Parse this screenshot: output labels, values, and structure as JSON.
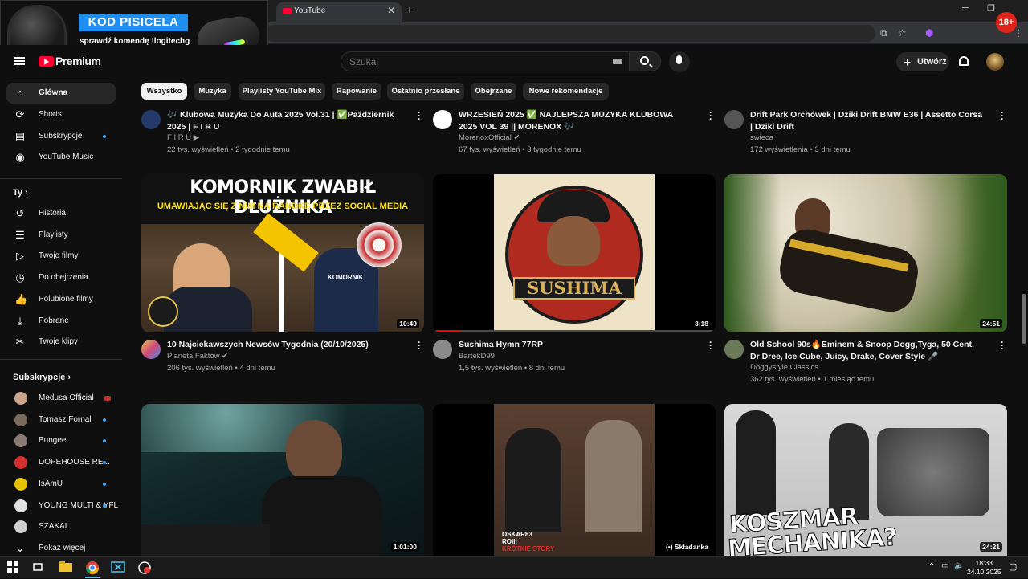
{
  "browser": {
    "tab_title": "YouTube",
    "tab_close": "✕",
    "new_tab": "+",
    "window_controls": [
      "─",
      "❐",
      "✕"
    ],
    "toolbar_icons": [
      "⧉",
      "☆",
      "⬢",
      "⋮"
    ]
  },
  "ad": {
    "badge": "KOD PISICELA",
    "tagline": "sprawdź komendę !logitechg",
    "age_badge": "18+"
  },
  "header": {
    "logo_text": "Premium",
    "search_placeholder": "Szukaj",
    "create_label": "Utwórz"
  },
  "sidebar": {
    "main": [
      {
        "label": "Główna",
        "icon": "home-icon",
        "glyph": "⌂"
      },
      {
        "label": "Shorts",
        "icon": "shorts-icon",
        "glyph": "⟳"
      },
      {
        "label": "Subskrypcje",
        "icon": "subscriptions-icon",
        "glyph": "▤"
      },
      {
        "label": "YouTube Music",
        "icon": "music-icon",
        "glyph": "◉"
      }
    ],
    "you_heading": "Ty",
    "you": [
      {
        "label": "Historia",
        "icon": "history-icon",
        "glyph": "↺"
      },
      {
        "label": "Playlisty",
        "icon": "playlists-icon",
        "glyph": "☰"
      },
      {
        "label": "Twoje filmy",
        "icon": "your-videos-icon",
        "glyph": "▷"
      },
      {
        "label": "Do obejrzenia",
        "icon": "watch-later-icon",
        "glyph": "◷"
      },
      {
        "label": "Polubione filmy",
        "icon": "liked-icon",
        "glyph": "👍"
      },
      {
        "label": "Pobrane",
        "icon": "download-icon",
        "glyph": "⤓"
      },
      {
        "label": "Twoje klipy",
        "icon": "clips-icon",
        "glyph": "✂"
      }
    ],
    "subs_heading": "Subskrypcje",
    "subs": [
      {
        "label": "Medusa Official",
        "color": "#c9a48b"
      },
      {
        "label": "Tomasz Fornal",
        "color": "#7a6a5c"
      },
      {
        "label": "Bungee",
        "color": "#8b7b74"
      },
      {
        "label": "DOPEHOUSE RE...",
        "color": "#d32f2f"
      },
      {
        "label": "IsAmU",
        "color": "#e6c200"
      },
      {
        "label": "YOUNG MULTI & YFL",
        "color": "#e0e0e0"
      },
      {
        "label": "SZAKAL",
        "color": "#cfcfcf"
      }
    ],
    "show_more": "Pokaż więcej"
  },
  "chips": [
    "Wszystko",
    "Muzyka",
    "Playlisty YouTube Mix",
    "Rapowanie",
    "Ostatnio przesłane",
    "Obejrzane",
    "Nowe rekomendacje"
  ],
  "videos_top": [
    {
      "title": "🎶 Klubowa Muzyka Do Auta 2025 Vol.31 | ✅Październik 2025 | F I R U",
      "channel": "F I R U ▶",
      "meta": "22 tys. wyświetleń • 2 tygodnie temu",
      "avatar": "#233a6b"
    },
    {
      "title": "WRZESIEŃ 2025 ✅ NAJLEPSZA MUZYKA KLUBOWA 2025 VOL 39 || MORENOX 🎶",
      "channel": "MorenoxOfficial ✔",
      "meta": "67 tys. wyświetleń • 3 tygodnie temu",
      "avatar": "#ffffff"
    },
    {
      "title": "Drift Park Orchówek | Dziki Drift BMW E36 | Assetto Corsa | Dziki Drift",
      "channel": "swieca",
      "meta": "172 wyświetlenia • 3 dni temu",
      "avatar": "#555555"
    }
  ],
  "videos_mid": [
    {
      "title": "10 Najciekawszych Newsów Tygodnia (20/10/2025)",
      "channel": "Planeta Faktów ✔",
      "meta": "206 tys. wyświetleń • 4 dni temu",
      "duration": "10:49",
      "thumb_line1": "KOMORNIK ZWABIŁ DŁUŻNIKA",
      "thumb_line2": "UMAWIAJĄC SIĘ Z NIM NA RANDKĘ PRZEZ SOCIAL MEDIA",
      "jacket_text": "KOMORNIK"
    },
    {
      "title": "Sushima Hymn 77RP",
      "channel": "BartekD99",
      "meta": "1,5 tys. wyświetleń • 8 dni temu",
      "duration": "3:18",
      "thumb_text": "SUSHIMA",
      "watched_progress": 0.1
    },
    {
      "title": "Old School 90s🔥Eminem & Snoop Dogg,Tyga, 50 Cent, Dr Dree, Ice Cube, Juicy, Drake, Cover Style 🎤",
      "channel": "Doggystyle Classics",
      "meta": "362 tys. wyświetleń • 1 miesiąc temu",
      "duration": "24:51"
    }
  ],
  "videos_bottom": [
    {
      "duration": "1:01:00"
    },
    {
      "duration": "(•) Składanka",
      "thumb_text1": "OSKAR83",
      "thumb_text2": "ROIII",
      "thumb_text3": "KRÓTKIE STORY"
    },
    {
      "duration": "24:21",
      "thumb_line1": "KOSZMAR",
      "thumb_line2": "MECHANIKA?"
    }
  ],
  "taskbar": {
    "time": "18:33",
    "date": "24.10.2025"
  }
}
